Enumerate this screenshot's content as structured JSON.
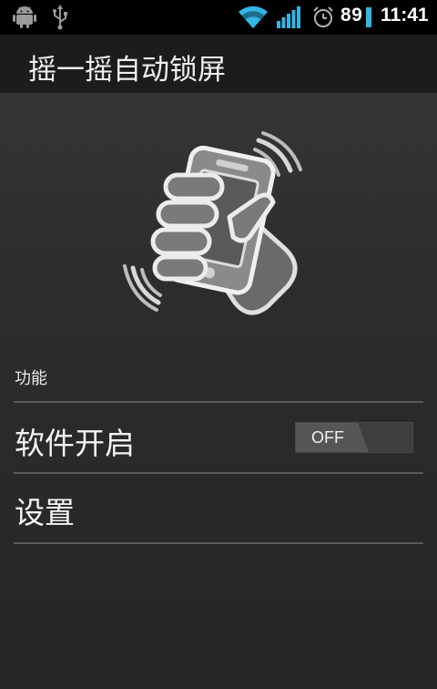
{
  "status_bar": {
    "battery_percent": "89",
    "time": "11:41",
    "icons": [
      "android-icon",
      "usb-icon",
      "wifi-icon",
      "signal-icon",
      "alarm-icon",
      "battery-icon"
    ],
    "battery_color": "#33b5e5"
  },
  "title_bar": {
    "title": "摇一摇自动锁屏"
  },
  "main": {
    "hero_icon": "hand-shaking-phone-icon",
    "section_header": "功能",
    "rows": [
      {
        "label": "软件开启",
        "toggle_label": "OFF",
        "toggle_state": "off"
      },
      {
        "label": "设置"
      }
    ]
  }
}
